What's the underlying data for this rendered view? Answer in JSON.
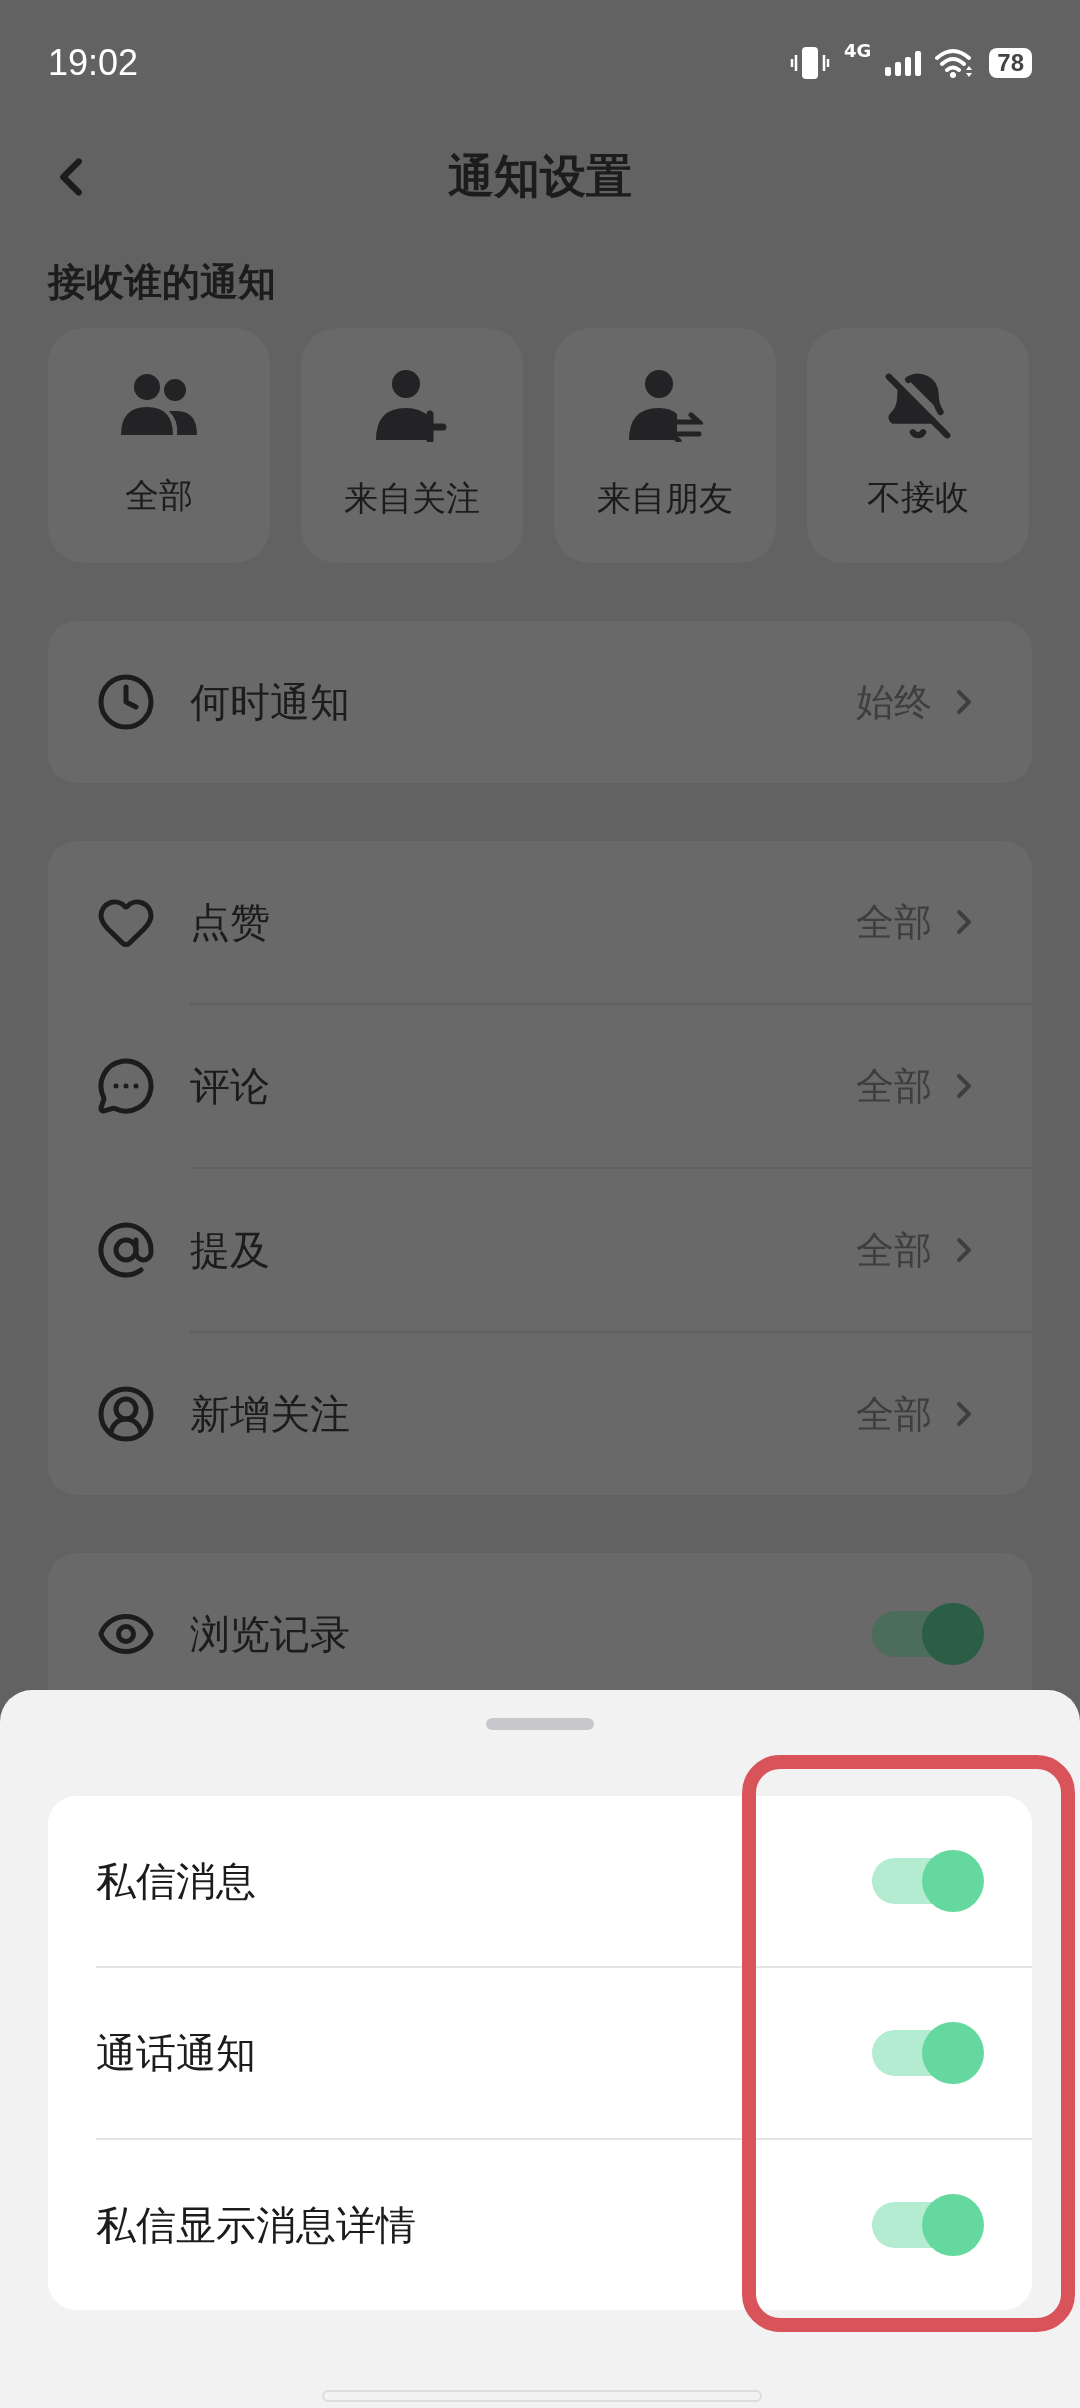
{
  "status_bar": {
    "time": "19:02",
    "network": "4G",
    "battery": "78"
  },
  "header": {
    "title": "通知设置"
  },
  "audience": {
    "title": "接收谁的通知",
    "options": [
      {
        "kind": "all",
        "label": "全部"
      },
      {
        "kind": "following",
        "label": "来自关注"
      },
      {
        "kind": "friends",
        "label": "来自朋友"
      },
      {
        "kind": "none",
        "label": "不接收"
      }
    ]
  },
  "groups": [
    {
      "rows": [
        {
          "kind": "link",
          "label": "何时通知",
          "value": "始终"
        }
      ]
    },
    {
      "rows": [
        {
          "kind": "link",
          "label": "点赞",
          "value": "全部"
        },
        {
          "kind": "link",
          "label": "评论",
          "value": "全部"
        },
        {
          "kind": "link",
          "label": "提及",
          "value": "全部"
        },
        {
          "kind": "link",
          "label": "新增关注",
          "value": "全部"
        }
      ]
    },
    {
      "rows": [
        {
          "kind": "toggle",
          "label": "浏览记录",
          "on": true
        }
      ]
    }
  ],
  "sheet": {
    "rows": [
      {
        "label": "私信消息",
        "on": true
      },
      {
        "label": "通话通知",
        "on": true
      },
      {
        "label": "私信显示消息详情",
        "on": true
      }
    ]
  }
}
